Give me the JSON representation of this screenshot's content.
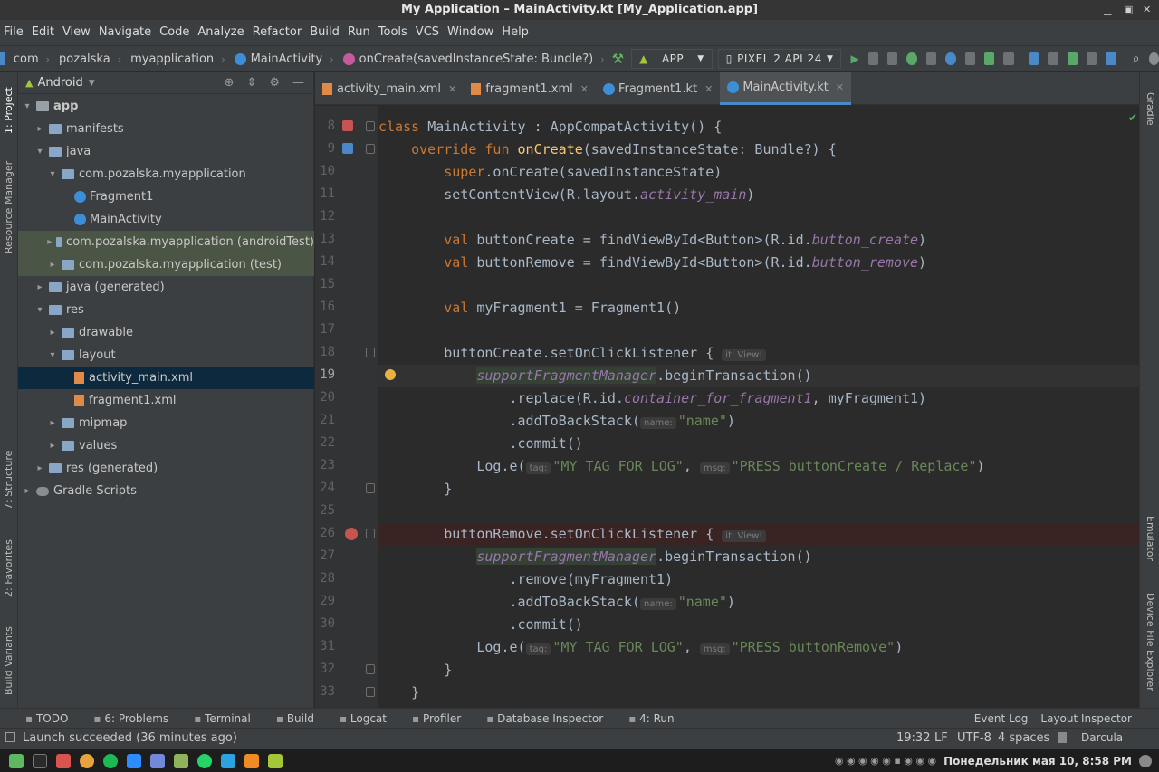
{
  "window": {
    "title": "My Application – MainActivity.kt [My_Application.app]"
  },
  "menu": [
    "File",
    "Edit",
    "View",
    "Navigate",
    "Code",
    "Analyze",
    "Refactor",
    "Build",
    "Run",
    "Tools",
    "VCS",
    "Window",
    "Help"
  ],
  "breadcrumb": [
    "com",
    "pozalska",
    "myapplication",
    "MainActivity",
    "onCreate(savedInstanceState: Bundle?)"
  ],
  "toolbar": {
    "run_config": "APP",
    "device": "PIXEL 2 API 24"
  },
  "left_tools": [
    "1: Project",
    "Resource Manager",
    "7: Structure",
    "2: Favorites",
    "Build Variants"
  ],
  "right_tools": [
    "Gradle",
    "Emulator",
    "Device File Explorer"
  ],
  "project": {
    "view": "Android",
    "tree": [
      {
        "label": "app",
        "depth": 0,
        "type": "module"
      },
      {
        "label": "manifests",
        "depth": 1,
        "type": "folder"
      },
      {
        "label": "java",
        "depth": 1,
        "type": "folder"
      },
      {
        "label": "com.pozalska.myapplication",
        "depth": 2,
        "type": "folder"
      },
      {
        "label": "Fragment1",
        "depth": 3,
        "type": "kt"
      },
      {
        "label": "MainActivity",
        "depth": 3,
        "type": "kt"
      },
      {
        "label": "com.pozalska.myapplication (androidTest)",
        "depth": 2,
        "type": "folder",
        "test": true
      },
      {
        "label": "com.pozalska.myapplication (test)",
        "depth": 2,
        "type": "folder",
        "test": true
      },
      {
        "label": "java (generated)",
        "depth": 1,
        "type": "folder"
      },
      {
        "label": "res",
        "depth": 1,
        "type": "folder"
      },
      {
        "label": "drawable",
        "depth": 2,
        "type": "folder"
      },
      {
        "label": "layout",
        "depth": 2,
        "type": "folder"
      },
      {
        "label": "activity_main.xml",
        "depth": 3,
        "type": "xml",
        "selected": true
      },
      {
        "label": "fragment1.xml",
        "depth": 3,
        "type": "xml"
      },
      {
        "label": "mipmap",
        "depth": 2,
        "type": "folder"
      },
      {
        "label": "values",
        "depth": 2,
        "type": "folder"
      },
      {
        "label": "res (generated)",
        "depth": 1,
        "type": "folder"
      },
      {
        "label": "Gradle Scripts",
        "depth": 0,
        "type": "gradle"
      }
    ]
  },
  "tabs": [
    {
      "label": "activity_main.xml",
      "icon": "xml"
    },
    {
      "label": "fragment1.xml",
      "icon": "xml"
    },
    {
      "label": "Fragment1.kt",
      "icon": "kt"
    },
    {
      "label": "MainActivity.kt",
      "icon": "kt",
      "active": true
    }
  ],
  "editor": {
    "current_line": 19,
    "lines": [
      {
        "n": "8",
        "c": [
          [
            "kw",
            "class "
          ],
          [
            "",
            "MainActivity : AppCompatActivity() {"
          ]
        ]
      },
      {
        "n": "9",
        "c": [
          [
            "",
            "    "
          ],
          [
            "kw",
            "override fun "
          ],
          [
            "fn",
            "onCreate"
          ],
          [
            "",
            "(savedInstanceState: Bundle?) {"
          ]
        ]
      },
      {
        "n": "10",
        "c": [
          [
            "",
            "        "
          ],
          [
            "kw",
            "super"
          ],
          [
            "",
            ".onCreate(savedInstanceState)"
          ]
        ]
      },
      {
        "n": "11",
        "c": [
          [
            "",
            "        setContentView(R.layout."
          ],
          [
            "it",
            "activity_main"
          ],
          [
            "",
            ")"
          ]
        ]
      },
      {
        "n": "12",
        "c": []
      },
      {
        "n": "13",
        "c": [
          [
            "",
            "        "
          ],
          [
            "kw",
            "val "
          ],
          [
            "",
            "buttonCreate = findViewById<Button>(R.id."
          ],
          [
            "it",
            "button_create"
          ],
          [
            "",
            ")"
          ]
        ]
      },
      {
        "n": "14",
        "c": [
          [
            "",
            "        "
          ],
          [
            "kw",
            "val "
          ],
          [
            "",
            "buttonRemove = findViewById<Button>(R.id."
          ],
          [
            "it",
            "button_remove"
          ],
          [
            "",
            ")"
          ]
        ]
      },
      {
        "n": "15",
        "c": []
      },
      {
        "n": "16",
        "c": [
          [
            "",
            "        "
          ],
          [
            "kw",
            "val "
          ],
          [
            "",
            "myFragment1 = Fragment1()"
          ]
        ]
      },
      {
        "n": "17",
        "c": []
      },
      {
        "n": "18",
        "c": [
          [
            "",
            "        buttonCreate.setOnClickListener { "
          ],
          [
            "hint",
            "it: View!"
          ]
        ]
      },
      {
        "n": "19",
        "c": [
          [
            "",
            "            "
          ],
          [
            "it hl",
            "supportFragmentManager"
          ],
          [
            "",
            ".beginTransaction()"
          ]
        ]
      },
      {
        "n": "20",
        "c": [
          [
            "",
            "                .replace(R.id."
          ],
          [
            "it",
            "container_for_fragment1"
          ],
          [
            "",
            ", myFragment1)"
          ]
        ]
      },
      {
        "n": "21",
        "c": [
          [
            "",
            "                .addToBackStack("
          ],
          [
            "hint",
            "name:"
          ],
          [
            "str",
            "\"name\""
          ],
          [
            "",
            ")"
          ]
        ]
      },
      {
        "n": "22",
        "c": [
          [
            "",
            "                .commit()"
          ]
        ]
      },
      {
        "n": "23",
        "c": [
          [
            "",
            "            Log.e("
          ],
          [
            "hint",
            "tag:"
          ],
          [
            "str",
            "\"MY TAG FOR LOG\""
          ],
          [
            "",
            ", "
          ],
          [
            "hint",
            "msg:"
          ],
          [
            "str",
            "\"PRESS buttonCreate / Replace\""
          ],
          [
            "",
            ")"
          ]
        ]
      },
      {
        "n": "24",
        "c": [
          [
            "",
            "        }"
          ]
        ]
      },
      {
        "n": "25",
        "c": []
      },
      {
        "n": "26",
        "c": [
          [
            "",
            "        buttonRemove.setOnClickListener { "
          ],
          [
            "hint",
            "it: View!"
          ]
        ]
      },
      {
        "n": "27",
        "c": [
          [
            "",
            "            "
          ],
          [
            "it hl",
            "supportFragmentManager"
          ],
          [
            "",
            ".beginTransaction()"
          ]
        ]
      },
      {
        "n": "28",
        "c": [
          [
            "",
            "                .remove(myFragment1)"
          ]
        ]
      },
      {
        "n": "29",
        "c": [
          [
            "",
            "                .addToBackStack("
          ],
          [
            "hint",
            "name:"
          ],
          [
            "str",
            "\"name\""
          ],
          [
            "",
            ")"
          ]
        ]
      },
      {
        "n": "30",
        "c": [
          [
            "",
            "                .commit()"
          ]
        ]
      },
      {
        "n": "31",
        "c": [
          [
            "",
            "            Log.e("
          ],
          [
            "hint",
            "tag:"
          ],
          [
            "str",
            "\"MY TAG FOR LOG\""
          ],
          [
            "",
            ", "
          ],
          [
            "hint",
            "msg:"
          ],
          [
            "str",
            "\"PRESS buttonRemove\""
          ],
          [
            "",
            ")"
          ]
        ]
      },
      {
        "n": "32",
        "c": [
          [
            "",
            "        }"
          ]
        ]
      },
      {
        "n": "33",
        "c": [
          [
            "",
            "    }"
          ]
        ]
      }
    ]
  },
  "bottom_tools": [
    "TODO",
    "6: Problems",
    "Terminal",
    "Build",
    "Logcat",
    "Profiler",
    "Database Inspector",
    "4: Run"
  ],
  "bottom_right_tools": [
    "Event Log",
    "Layout Inspector"
  ],
  "status": {
    "message": "Launch succeeded (36 minutes ago)",
    "position": "19:32",
    "line_sep": "LF",
    "encoding": "UTF-8",
    "indent": "4 spaces",
    "theme": "Darcula"
  },
  "taskbar": {
    "clock": "Понедельник мая 10, 8:58 PM"
  },
  "colors": {
    "accent": "#4a88c7",
    "breakpoint": "#c75450",
    "selection": "#0d293e"
  }
}
